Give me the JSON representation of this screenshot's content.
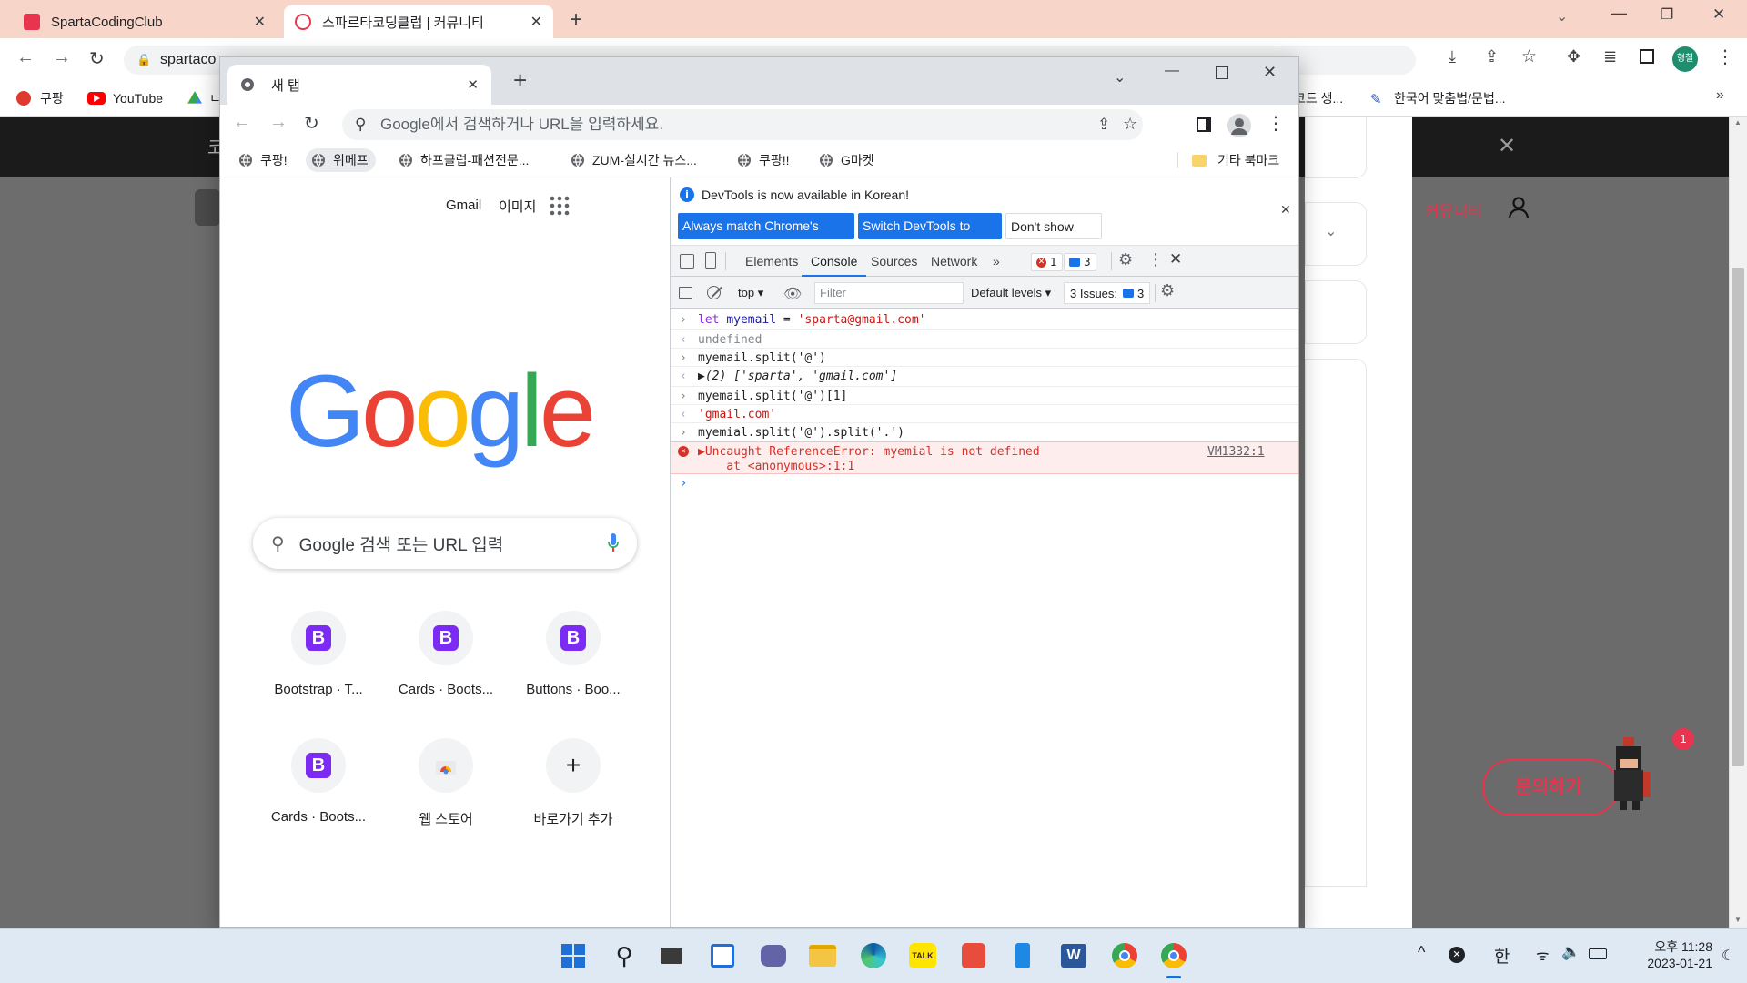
{
  "back_browser": {
    "tabs": [
      {
        "title": "SpartaCodingClub",
        "active": false
      },
      {
        "title": "스파르타코딩클럽 | 커뮤니티",
        "active": true
      }
    ],
    "url": "spartaco",
    "bookmarks": [
      {
        "label": "쿠팡"
      },
      {
        "label": "YouTube"
      },
      {
        "label": "ㄴ"
      },
      {
        "label": "코드 생..."
      },
      {
        "label": "한국어 맞춤법/문법..."
      }
    ],
    "page": {
      "header_left": "코",
      "community_link": "커뮤니티",
      "inquiry_button": "문의하기",
      "notification_count": "1"
    }
  },
  "front_browser": {
    "tab_title": "새 탭",
    "omnibox_placeholder": "Google에서 검색하거나 URL을 입력하세요.",
    "bookmarks": [
      "쿠팡!",
      "위메프",
      "하프클럽-패션전문...",
      "ZUM-실시간 뉴스...",
      "쿠팡!!",
      "G마켓"
    ],
    "other_bookmarks": "기타 북마크",
    "ntp": {
      "links": [
        "Gmail",
        "이미지"
      ],
      "logo": "Google",
      "search_placeholder": "Google 검색 또는 URL 입력",
      "shortcuts": [
        {
          "label": "Bootstrap · T...",
          "icon": "B"
        },
        {
          "label": "Cards · Boots...",
          "icon": "B"
        },
        {
          "label": "Buttons · Boo...",
          "icon": "B"
        },
        {
          "label": "Cards · Boots...",
          "icon": "B"
        },
        {
          "label": "웹 스토어",
          "icon": "web-store"
        },
        {
          "label": "바로가기 추가",
          "icon": "+"
        }
      ]
    }
  },
  "devtools": {
    "infobar_message": "DevTools is now available in Korean!",
    "buttons": [
      "Always match Chrome's language",
      "Switch DevTools to Korean",
      "Don't show again"
    ],
    "tabs": [
      "Elements",
      "Console",
      "Sources",
      "Network"
    ],
    "more_tabs": "»",
    "error_count": "1",
    "message_count": "3",
    "context": "top",
    "filter_placeholder": "Filter",
    "levels": "Default levels",
    "issues_label": "3 Issues:",
    "issues_count": "3",
    "console": [
      {
        "kind": "input",
        "prefix": "let ",
        "name": "myemail",
        "rest": " = ",
        "str": "'sparta@gmail.com'"
      },
      {
        "kind": "output",
        "text": "undefined"
      },
      {
        "kind": "input",
        "text": "myemail.split('@')"
      },
      {
        "kind": "output-array",
        "text": "▶(2) ['sparta', 'gmail.com']"
      },
      {
        "kind": "input",
        "text": "myemail.split('@')[1]"
      },
      {
        "kind": "output-string",
        "text": "'gmail.com'"
      },
      {
        "kind": "input",
        "text": "myemial.split('@').split('.')"
      },
      {
        "kind": "error",
        "text": "▶Uncaught ReferenceError: myemial is not defined",
        "subtext": "    at <anonymous>:1:1",
        "source": "VM1332:1"
      }
    ]
  },
  "taskbar": {
    "ime": "한",
    "time": "오후 11:28",
    "date": "2023-01-21"
  },
  "colors": {
    "devtools_blue": "#1a73e8",
    "error_red": "#d93025",
    "sparta_red": "#e8344e",
    "bootstrap_purple": "#7c2bf5"
  }
}
